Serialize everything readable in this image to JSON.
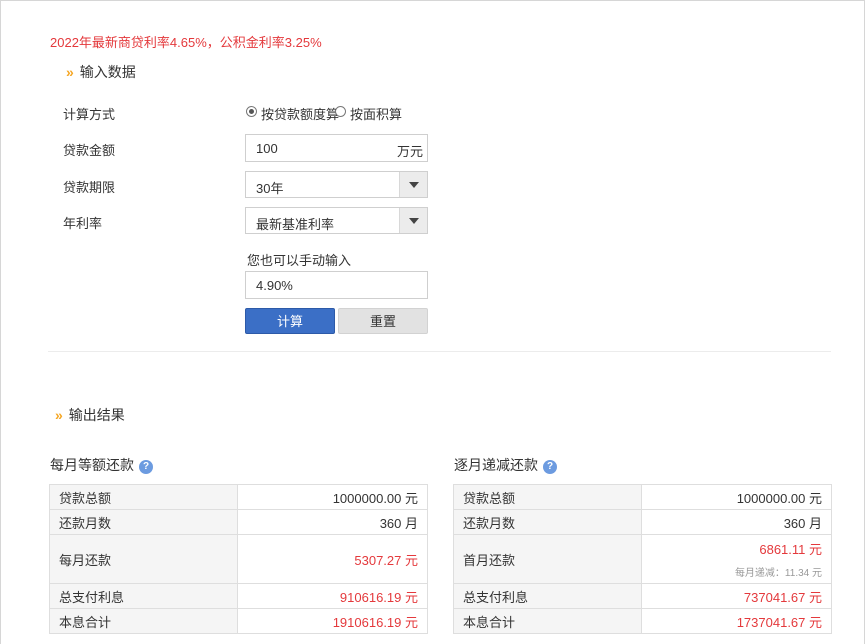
{
  "notice": "2022年最新商贷利率4.65%，公积金利率3.25%",
  "input_section": {
    "title": "输入数据",
    "calc_method_label": "计算方式",
    "calc_method_options": [
      "按贷款额度算",
      "按面积算"
    ],
    "calc_method_selected": "按贷款额度算",
    "loan_amount_label": "贷款金额",
    "loan_amount_value": "100",
    "loan_amount_unit": "万元",
    "loan_term_label": "贷款期限",
    "loan_term_value": "30年",
    "rate_label": "年利率",
    "rate_select_value": "最新基准利率",
    "manual_hint": "您也可以手动输入",
    "manual_rate_value": "4.90%",
    "calc_button": "计算",
    "reset_button": "重置"
  },
  "output_section": {
    "title": "输出结果",
    "equal_payment": {
      "title": "每月等额还款",
      "rows": [
        {
          "key": "贷款总额",
          "value": "1000000.00 元"
        },
        {
          "key": "还款月数",
          "value": "360 月"
        },
        {
          "key": "每月还款",
          "value": "5307.27 元"
        },
        {
          "key": "总支付利息",
          "value": "910616.19 元"
        },
        {
          "key": "本息合计",
          "value": "1910616.19 元"
        }
      ]
    },
    "decreasing_payment": {
      "title": "逐月递减还款",
      "rows": [
        {
          "key": "贷款总额",
          "value": "1000000.00 元"
        },
        {
          "key": "还款月数",
          "value": "360 月"
        },
        {
          "key": "首月还款",
          "value": "6861.11 元",
          "sub": "每月递减：11.34 元"
        },
        {
          "key": "总支付利息",
          "value": "737041.67 元"
        },
        {
          "key": "本息合计",
          "value": "1737041.67 元"
        }
      ]
    }
  },
  "colors": {
    "accent_red": "#e4393c",
    "button_blue": "#3b6fc6",
    "chevron_orange": "#f5a623"
  }
}
